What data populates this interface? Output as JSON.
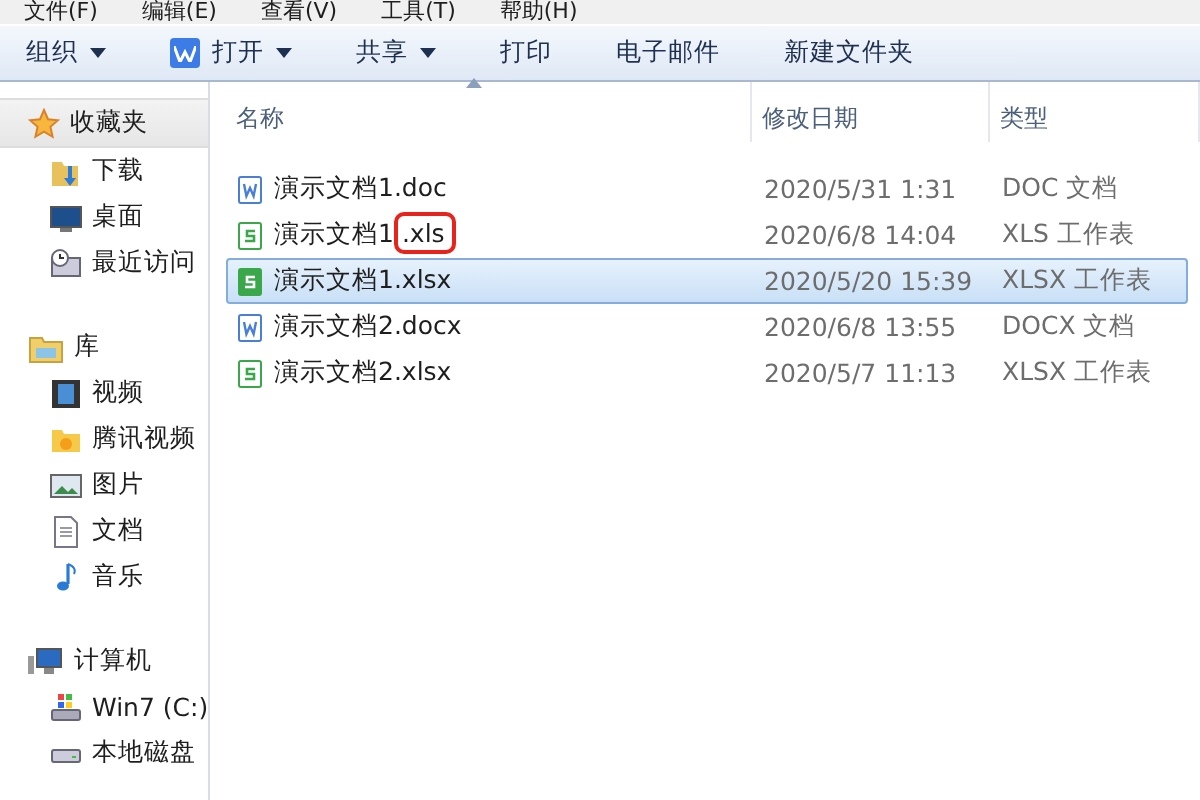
{
  "menu_bar": [
    "文件(F)",
    "编辑(E)",
    "查看(V)",
    "工具(T)",
    "帮助(H)"
  ],
  "toolbar": [
    {
      "label": "组织",
      "dropdown": true
    },
    {
      "label": "打开",
      "dropdown": true
    },
    {
      "label": "共享",
      "dropdown": true
    },
    {
      "label": "打印",
      "dropdown": false
    },
    {
      "label": "电子邮件",
      "dropdown": false
    },
    {
      "label": "新建文件夹",
      "dropdown": false
    }
  ],
  "sidebar": [
    {
      "label": "收藏夹",
      "selected": true,
      "children": [
        {
          "label": "下载",
          "selected": false
        },
        {
          "label": "桌面",
          "selected": false
        },
        {
          "label": "最近访问",
          "selected": false
        }
      ]
    },
    {
      "label": "库",
      "selected": false,
      "children": [
        {
          "label": "视频",
          "selected": false
        },
        {
          "label": "腾讯视频",
          "selected": false
        },
        {
          "label": "图片",
          "selected": false
        },
        {
          "label": "文档",
          "selected": false
        },
        {
          "label": "音乐",
          "selected": false
        }
      ]
    },
    {
      "label": "计算机",
      "selected": false,
      "children": [
        {
          "label": "Win7 (C:)",
          "selected": false
        },
        {
          "label": "本地磁盘",
          "selected": false
        }
      ]
    }
  ],
  "table": {
    "columns": [
      {
        "label": "名称",
        "sorted": true
      },
      {
        "label": "修改日期",
        "sorted": false
      },
      {
        "label": "类型",
        "sorted": false
      }
    ],
    "rows": [
      {
        "name_stem": "演示文档1",
        "name_ext": ".doc",
        "kind": "word",
        "date": "2020/5/31 1:31",
        "type": "DOC 文档",
        "selected": false,
        "annotated": false
      },
      {
        "name_stem": "演示文档1",
        "name_ext": ".xls",
        "kind": "sheet",
        "date": "2020/6/8 14:04",
        "type": "XLS 工作表",
        "selected": false,
        "annotated": true
      },
      {
        "name_stem": "演示文档1",
        "name_ext": ".xlsx",
        "kind": "sheet",
        "date": "2020/5/20 15:39",
        "type": "XLSX 工作表",
        "selected": true,
        "annotated": false
      },
      {
        "name_stem": "演示文档2",
        "name_ext": ".docx",
        "kind": "word",
        "date": "2020/6/8 13:55",
        "type": "DOCX 文档",
        "selected": false,
        "annotated": false
      },
      {
        "name_stem": "演示文档2",
        "name_ext": ".xlsx",
        "kind": "sheet",
        "date": "2020/5/7 11:13",
        "type": "XLSX 工作表",
        "selected": false,
        "annotated": false
      }
    ]
  }
}
